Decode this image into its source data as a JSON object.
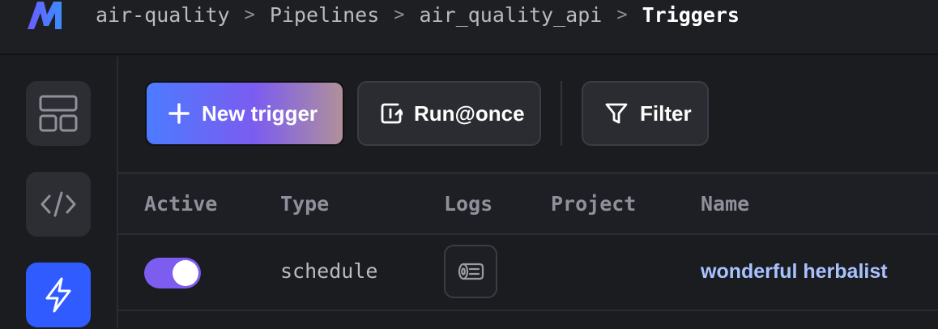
{
  "breadcrumb": {
    "items": [
      "air-quality",
      "Pipelines",
      "air_quality_api",
      "Triggers"
    ],
    "separator": ">"
  },
  "sidebar": {
    "items": [
      {
        "name": "dashboard",
        "icon": "layout-icon",
        "active": false
      },
      {
        "name": "code",
        "icon": "code-icon",
        "active": false
      },
      {
        "name": "triggers",
        "icon": "lightning-icon",
        "active": true
      }
    ]
  },
  "toolbar": {
    "new_trigger_label": "New trigger",
    "run_once_label": "Run@once",
    "filter_label": "Filter"
  },
  "table": {
    "columns": [
      "Active",
      "Type",
      "Logs",
      "Project",
      "Name"
    ],
    "rows": [
      {
        "active": true,
        "type": "schedule",
        "logs_icon": "logs-icon",
        "project": "",
        "name": "wonderful herbalist"
      }
    ]
  },
  "colors": {
    "accent": "#2f5bff",
    "toggle_on": "#7d5cf0",
    "link": "#a9c2ff",
    "background": "#1b1c20"
  }
}
